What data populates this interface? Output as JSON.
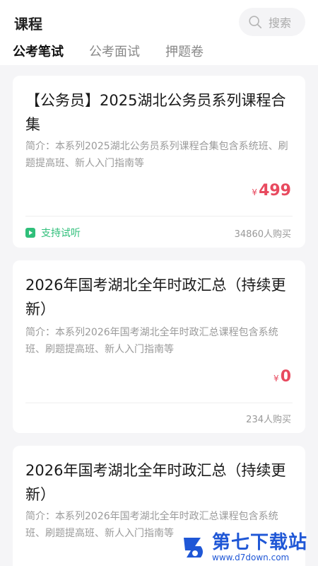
{
  "header": {
    "title": "课程",
    "search_label": "搜索"
  },
  "tabs": [
    {
      "label": "公考笔试",
      "active": true
    },
    {
      "label": "公考面试",
      "active": false
    },
    {
      "label": "押题卷",
      "active": false
    }
  ],
  "courses": [
    {
      "title": "【公务员】2025湖北公务员系列课程合集",
      "desc": "简介：本系列2025湖北公务员系列课程合集包含系统班、刷题提高班、新人入门指南等",
      "currency": "¥",
      "price": "499",
      "trial": "支持试听",
      "buyers": "34860人购买"
    },
    {
      "title": "2026年国考湖北全年时政汇总（持续更新）",
      "desc": "简介：本系列2026年国考湖北全年时政汇总课程包含系统班、刷题提高班、新人入门指南等",
      "currency": "¥",
      "price": "0",
      "buyers": "234人购买"
    },
    {
      "title": "2026年国考湖北全年时政汇总（持续更新）",
      "desc": "简介：本系列2026年国考湖北全年时政汇总课程包含系统班、刷题提高班、新人入门指南等"
    }
  ],
  "watermark": {
    "name": "第七下载站",
    "url": "www.d7down.com"
  },
  "colors": {
    "accent": "#3ad28c",
    "price": "#e84a5f",
    "trial": "#2fbf7a",
    "watermark": "#1f57d6"
  }
}
